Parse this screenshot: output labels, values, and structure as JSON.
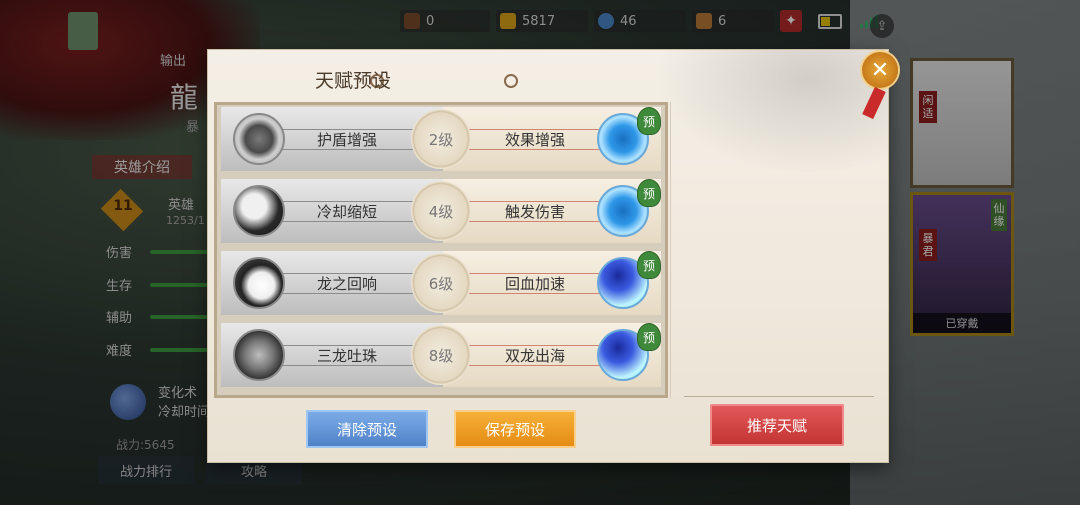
{
  "topbar": {
    "res1": "0",
    "res2": "5817",
    "res3": "46",
    "res4": "6"
  },
  "hero_panel": {
    "output_label": "输出",
    "hero_name": "龍",
    "hero_sub": "暴",
    "intro_tab": "英雄介绍",
    "level": "11",
    "fame_label": "英雄",
    "fame_value": "1253/1",
    "stats": [
      "伤害",
      "生存",
      "辅助",
      "难度"
    ],
    "skill_name": "变化术",
    "skill_cd": "冷却时间",
    "power": "战力:5645",
    "rank_button": "战力排行",
    "guide_button": "攻略"
  },
  "skins": {
    "card1_tag": "闲适",
    "card2_tag": "暴君",
    "card2_tag2": "仙缘",
    "worn_label": "已穿戴"
  },
  "modal": {
    "title": "天赋预设",
    "close_label": "✕",
    "preset_tag": "预",
    "rows": [
      {
        "left": "护盾增强",
        "level": "2级",
        "right": "效果增强"
      },
      {
        "left": "冷却缩短",
        "level": "4级",
        "right": "触发伤害"
      },
      {
        "left": "龙之回响",
        "level": "6级",
        "right": "回血加速"
      },
      {
        "left": "三龙吐珠",
        "level": "8级",
        "right": "双龙出海"
      }
    ],
    "clear_button": "清除预设",
    "save_button": "保存预设",
    "recommend_button": "推荐天赋"
  }
}
